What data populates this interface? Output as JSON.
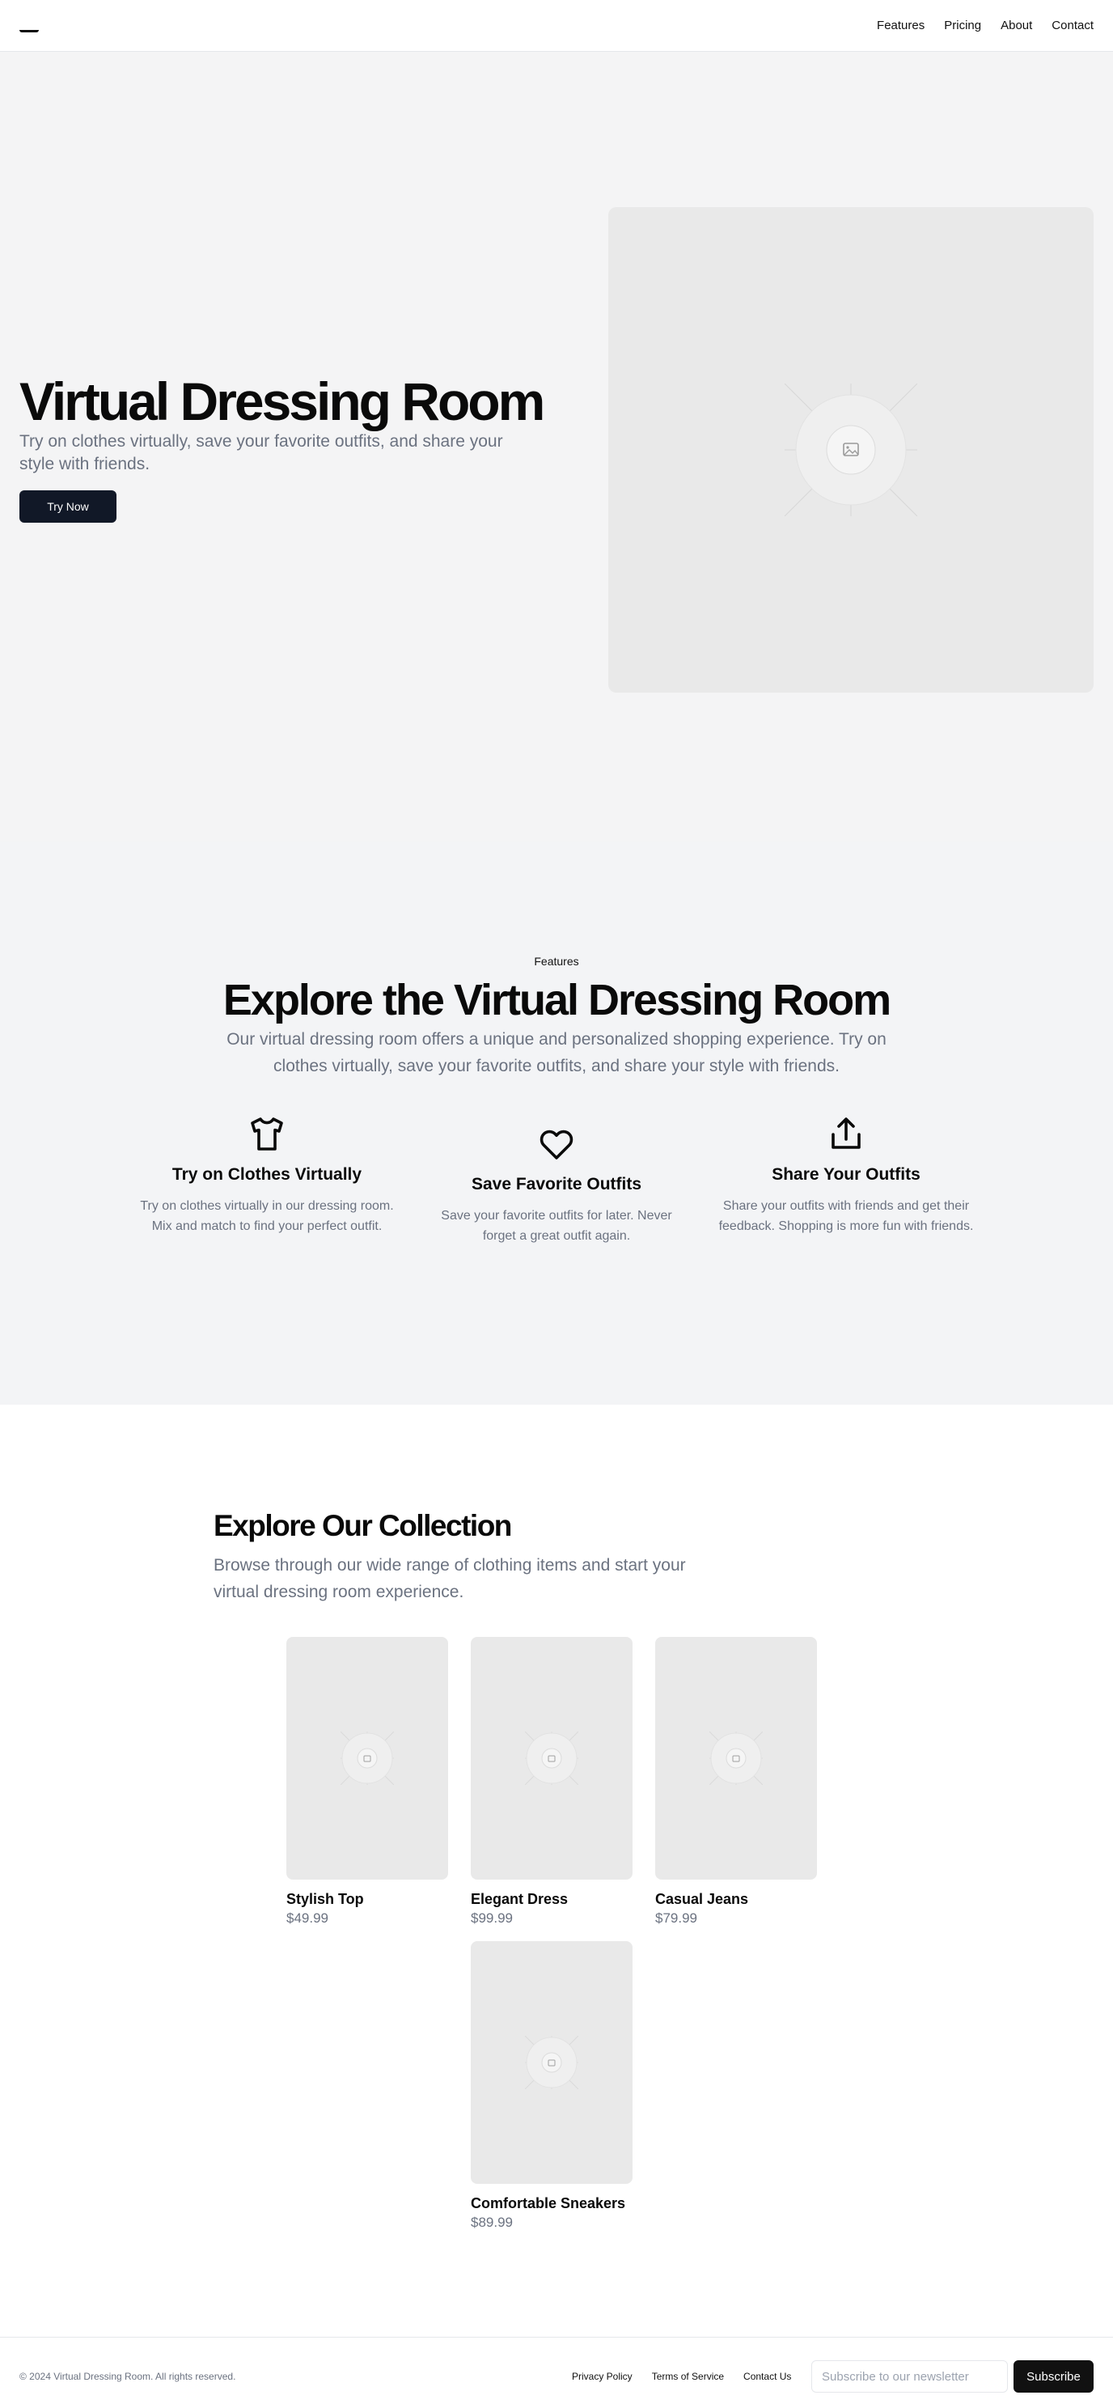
{
  "header": {
    "logo_icon": "brand-mark-icon",
    "nav": [
      "Features",
      "Pricing",
      "About",
      "Contact"
    ]
  },
  "hero": {
    "title": "Virtual Dressing Room",
    "subtitle": "Try on clothes virtually, save your favorite outfits, and share your style with friends.",
    "cta_label": "Try Now",
    "image_icon": "image-placeholder-icon"
  },
  "features": {
    "eyebrow": "Features",
    "title": "Explore the Virtual Dressing Room",
    "subtitle": "Our virtual dressing room offers a unique and personalized shopping experience. Try on clothes virtually, save your favorite outfits, and share your style with friends.",
    "items": [
      {
        "icon": "shirt-icon",
        "title": "Try on Clothes Virtually",
        "text": "Try on clothes virtually in our dressing room. Mix and match to find your perfect outfit."
      },
      {
        "icon": "heart-icon",
        "title": "Save Favorite Outfits",
        "text": "Save your favorite outfits for later. Never forget a great outfit again."
      },
      {
        "icon": "share-icon",
        "title": "Share Your Outfits",
        "text": "Share your outfits with friends and get their feedback. Shopping is more fun with friends."
      }
    ]
  },
  "collection": {
    "title": "Explore Our Collection",
    "subtitle": "Browse through our wide range of clothing items and start your virtual dressing room experience.",
    "products": [
      {
        "name": "Stylish Top",
        "price": "$49.99"
      },
      {
        "name": "Elegant Dress",
        "price": "$99.99"
      },
      {
        "name": "Casual Jeans",
        "price": "$79.99"
      },
      {
        "name": "Comfortable Sneakers",
        "price": "$89.99"
      }
    ]
  },
  "footer": {
    "copyright": "© 2024 Virtual Dressing Room. All rights reserved.",
    "links": [
      "Privacy Policy",
      "Terms of Service",
      "Contact Us"
    ],
    "newsletter_placeholder": "Subscribe to our newsletter",
    "subscribe_label": "Subscribe"
  },
  "colors": {
    "primary_button": "#111827",
    "hero_background": "#f4f4f5",
    "features_background": "#f3f4f6",
    "muted_text": "#6b7280",
    "placeholder": "#e9e9e9"
  }
}
